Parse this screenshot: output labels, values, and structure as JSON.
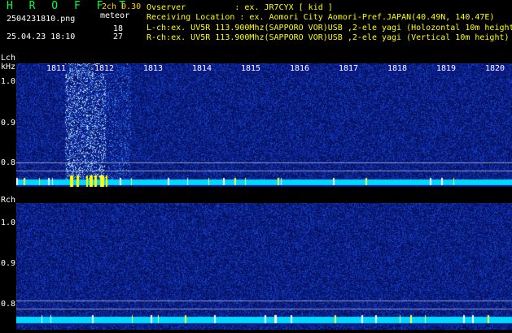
{
  "header": {
    "app_title": "H R O F F T",
    "version": "2ch 0.30",
    "filename": "2504231810.png",
    "meteor_label": "meteor",
    "lch_count": "18",
    "rch_count": "27",
    "datetime": "25.04.23 18:10",
    "observer": "Ovserver          : ex. JR7CYX [ kid ]",
    "location": "Receiving Location : ex. Aomori City Aomori-Pref.JAPAN(40.49N, 140.47E)",
    "lch_info": "L-ch:ex. UV5R 113.900Mhz(SAPPORO VOR)USB ,2-ele yagi (Holozontal 10m height)",
    "rch_info": "R-ch:ex. UV5R 113.900Mhz(SAPPORO VOR)USB ,2-ele yagi (Vertical 10m height)"
  },
  "lch": {
    "label": "Lch",
    "unit": "kHz",
    "yticks": [
      "1.0",
      "0.9",
      "0.8"
    ]
  },
  "rch": {
    "label": "Rch",
    "yticks": [
      "1.0",
      "0.9",
      "0.8"
    ]
  },
  "time_ticks": [
    "1811",
    "1812",
    "1813",
    "1814",
    "1815",
    "1816",
    "1817",
    "1818",
    "1819",
    "1820"
  ],
  "colors": {
    "background": "#000000",
    "spectrum_low": "#0a1a8a",
    "signal_band": "#00e0ff",
    "version_text": "#ffd200",
    "title_text": "#00ff40",
    "info_text": "#ffff00",
    "label_text": "#ffffff"
  }
}
